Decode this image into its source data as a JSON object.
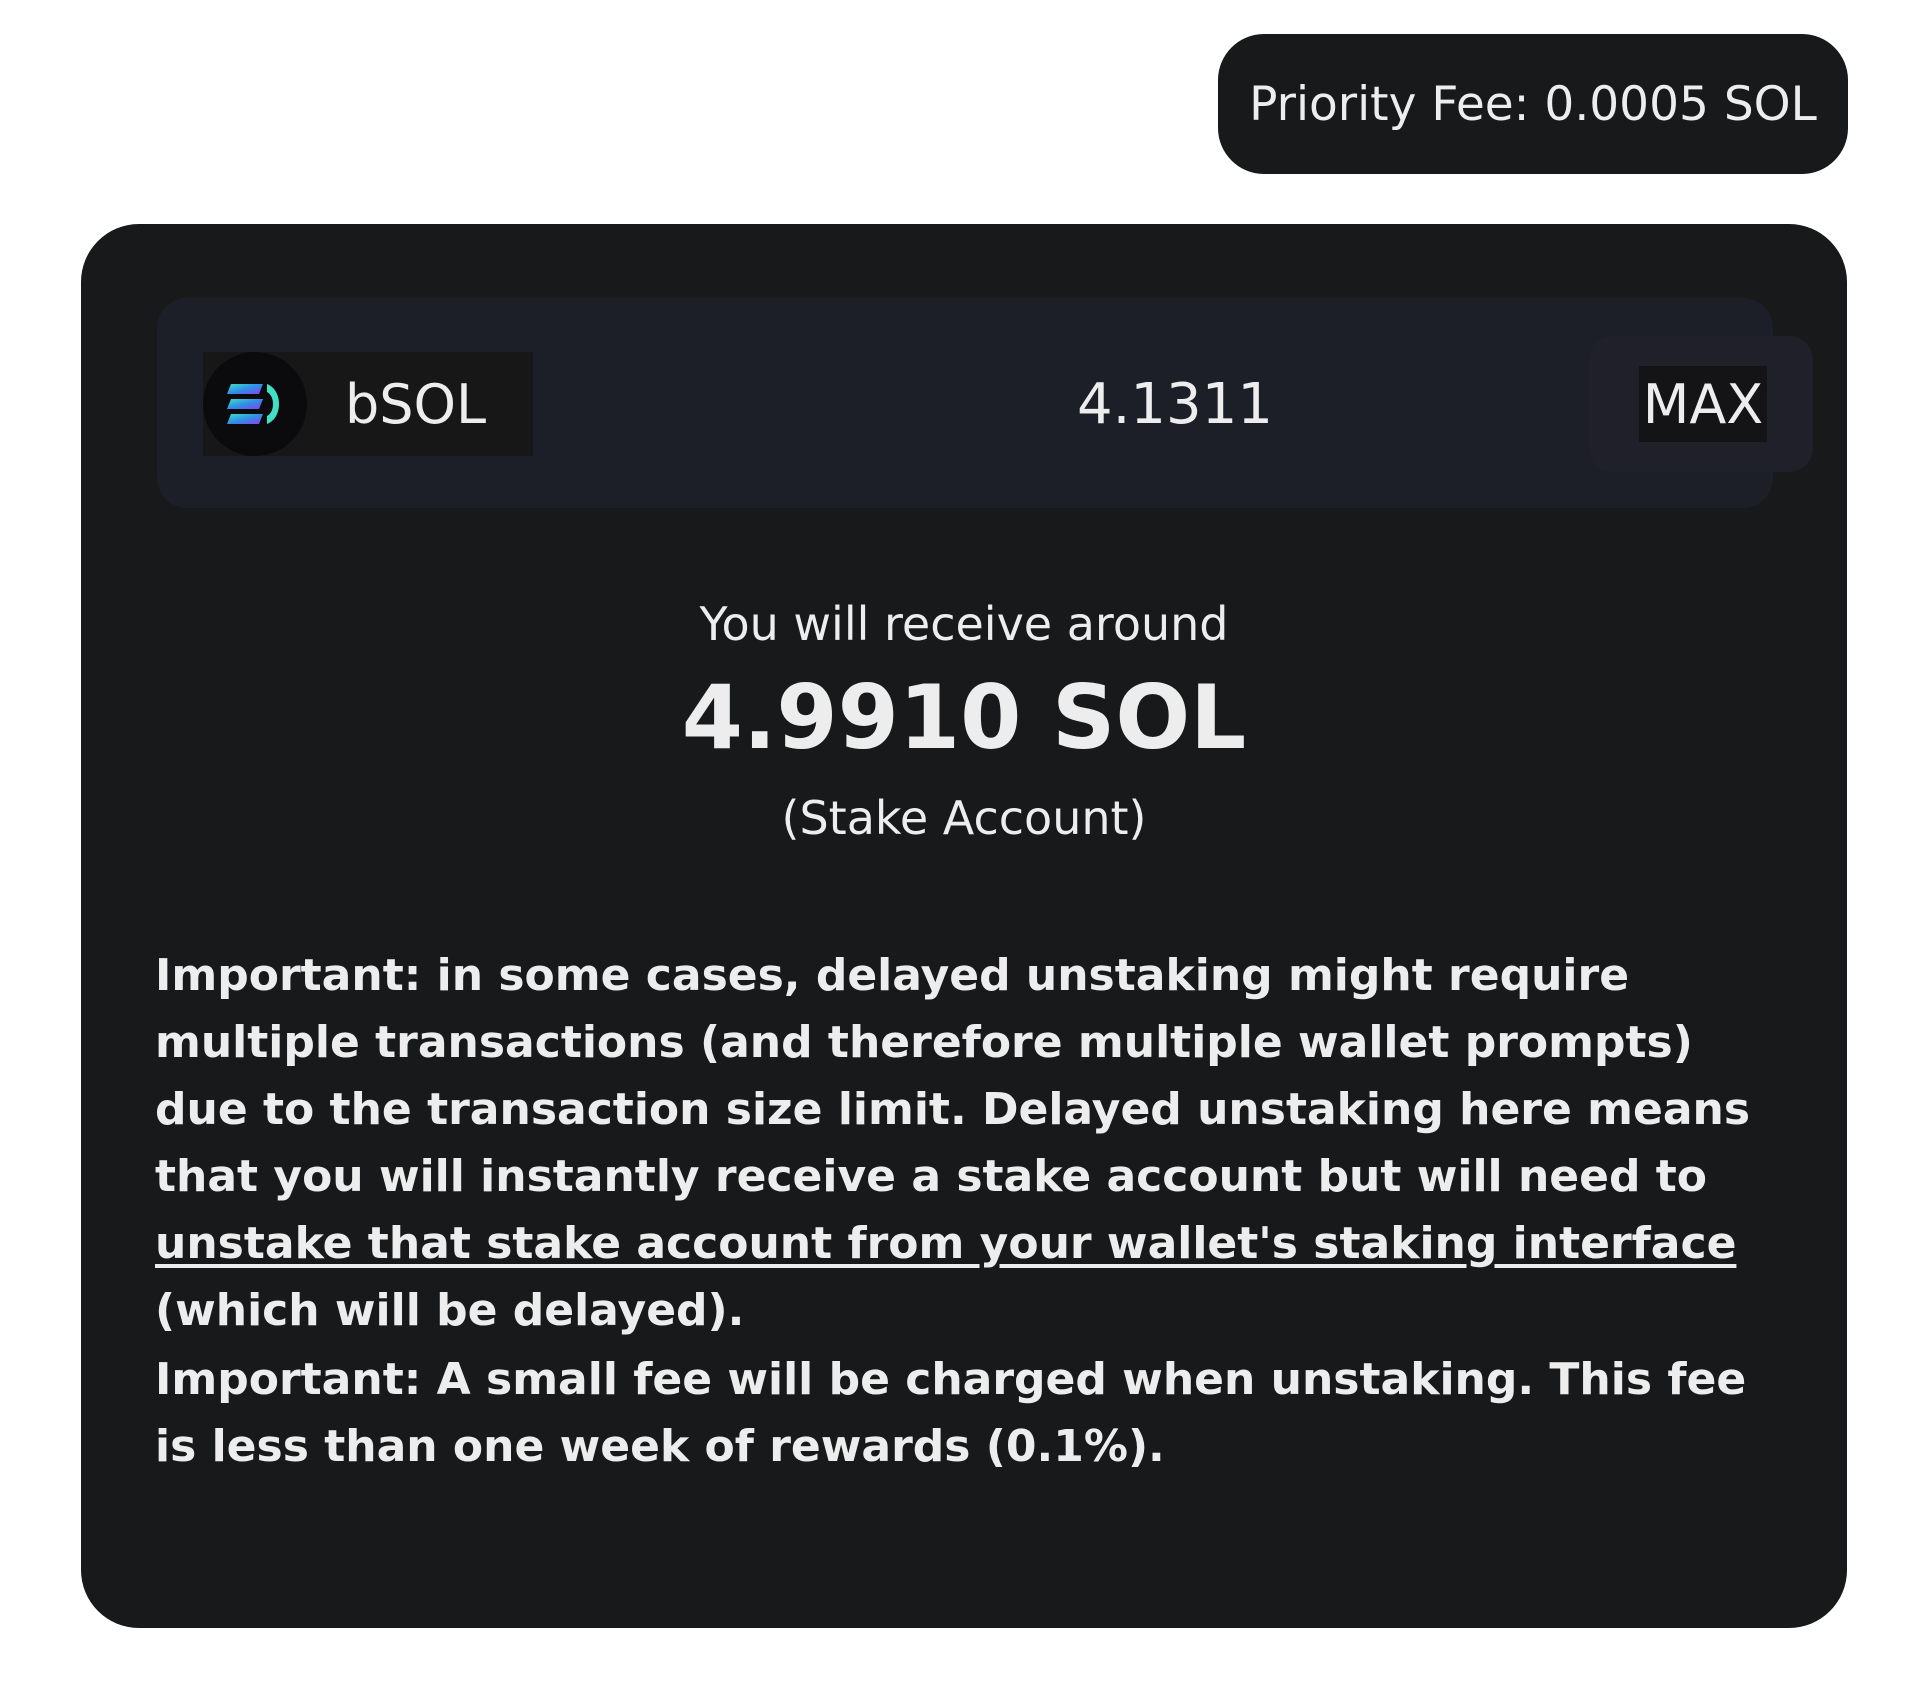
{
  "priority_fee": {
    "label": "Priority Fee: 0.0005 SOL"
  },
  "unstake_form": {
    "token": {
      "symbol": "bSOL",
      "icon": "bsol-token-icon"
    },
    "amount_value": "4.1311",
    "max_label": "MAX"
  },
  "receive": {
    "label": "You will receive around",
    "amount": "4.9910 SOL",
    "note": "(Stake Account)"
  },
  "notices": {
    "delayed_unstake_prefix": "Important: in some cases, delayed unstaking might require multiple transactions (and therefore multiple wallet prompts) due to the transaction size limit. Delayed unstaking here means that you will instantly receive a stake account but will need to ",
    "delayed_unstake_link": "unstake that stake account from your wallet's staking interface",
    "delayed_unstake_suffix": " (which will be delayed).",
    "fee_notice": "Important: A small fee will be charged when unstaking. This fee is less than one week of rewards (0.1%)."
  },
  "colors": {
    "panel": "#18191a",
    "input_row": "#1d1f28",
    "text": "#ededed",
    "logo_gradient": [
      "#3fe0c5",
      "#2f8fe6",
      "#8b3ff0"
    ]
  }
}
